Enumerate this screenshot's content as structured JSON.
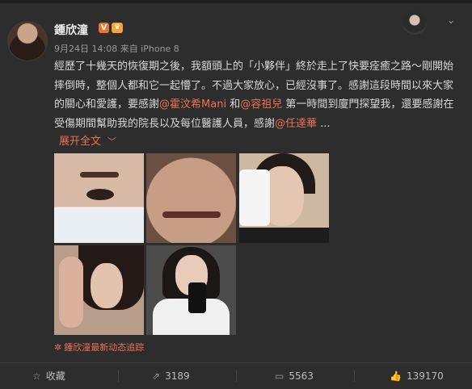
{
  "post": {
    "username": "鍾欣潼",
    "v_badge": "V",
    "crown_badge": "♛",
    "meta": "9月24日 14:08 来自 iPhone 8",
    "content_parts": {
      "p1": "經歷了十幾天的恢復期之後，我額頭上的「小夥伴」終於走上了快要痊癒之路～剛開始摔倒時，整個人都和它一起懵了。不過大家放心，已經沒事了。感謝這段時間以來大家的關心和愛護，要感謝",
      "m1": "@霍汶希Mani",
      "p2": " 和",
      "m2": "@容祖兒",
      "p3": " 第一時間到廈門探望我，還要感謝在受傷期間幫助我的院長以及每位醫護人員，感謝",
      "m3": "@任達華",
      "p4": " ..."
    },
    "expand_label": "展开全文",
    "expand_chevron": "﹀",
    "follow_label": "鍾欣潼最新动态追踪",
    "follow_icon": "✲"
  },
  "actions": {
    "favorite_label": "收藏",
    "repost_count": "3189",
    "comment_count": "5563",
    "like_count": "139170"
  },
  "icons": {
    "star": "☆",
    "repost": "⇗",
    "comment": "▭",
    "like": "👍",
    "top_chevron": "⌄"
  },
  "colors": {
    "background": "#2d2d2d",
    "accent": "#eb7350",
    "text": "#d8d8d8"
  }
}
